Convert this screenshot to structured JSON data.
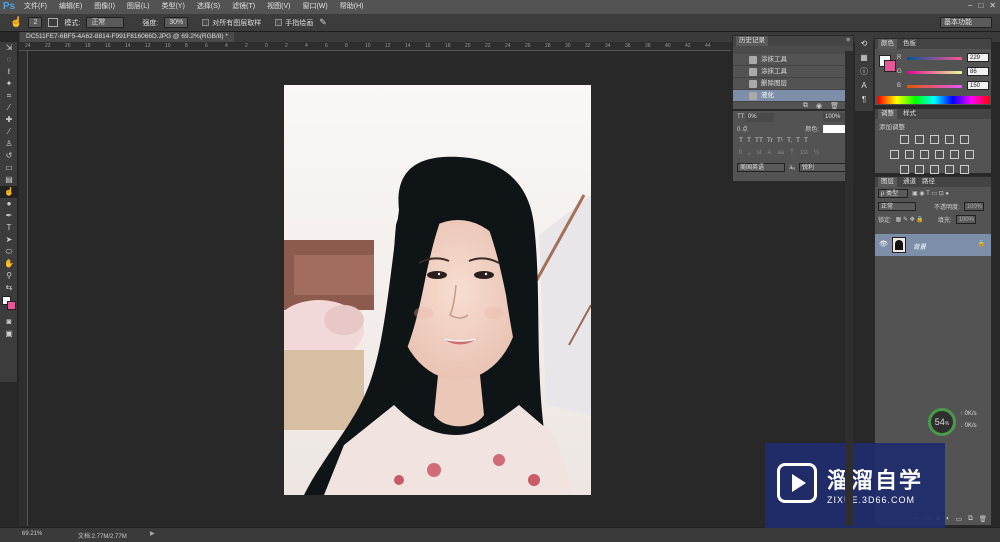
{
  "app": {
    "logo": "Ps"
  },
  "menubar": {
    "items": [
      "文件(F)",
      "编辑(E)",
      "图像(I)",
      "图层(L)",
      "类型(Y)",
      "选择(S)",
      "滤镜(T)",
      "视图(V)",
      "窗口(W)",
      "帮助(H)"
    ],
    "window_controls": [
      "−",
      "□",
      "✕"
    ]
  },
  "options": {
    "brush_size": "2",
    "mode_label": "模式:",
    "mode_value": "正常",
    "strength_label": "强度:",
    "strength_value": "30%",
    "sample_all_label": "对所有图层取样",
    "finger_paint_label": "手指绘画",
    "workspace": "基本功能"
  },
  "document": {
    "tab_title": "DC511FE7-6BF5-4A62-8814-F991F816066D.JPG @ 69.2%(RGB/8) *",
    "ruler_marks": [
      "24",
      "22",
      "20",
      "18",
      "16",
      "14",
      "12",
      "10",
      "8",
      "6",
      "4",
      "2",
      "0",
      "2",
      "4",
      "6",
      "8",
      "10",
      "12",
      "14",
      "16",
      "18",
      "20",
      "22",
      "24",
      "26",
      "28",
      "30",
      "32",
      "34",
      "36",
      "38",
      "40",
      "42",
      "44"
    ]
  },
  "status": {
    "zoom": "69.21%",
    "doc_info": "文档:2.77M/2.77M"
  },
  "history": {
    "title": "历史记录",
    "items": [
      {
        "label": "涂抹工具",
        "selected": false
      },
      {
        "label": "涂抹工具",
        "selected": false
      },
      {
        "label": "删除图层",
        "selected": false
      },
      {
        "label": "液化",
        "selected": true
      }
    ]
  },
  "character": {
    "row1_left": "0%",
    "row1_right": "100%",
    "tracking": "0 点",
    "color_label": "颜色:",
    "style_buttons": [
      "T",
      "T",
      "TT",
      "Tr",
      "T¹",
      "T,",
      "T",
      "T"
    ],
    "ligature_buttons": [
      "fi",
      "ℴ",
      "st",
      "A",
      "aa",
      "T",
      "1st",
      "½"
    ],
    "language": "美国英语",
    "aa_label": "aₐ",
    "antialias": "锐利"
  },
  "color_panel": {
    "tabs": [
      "颜色",
      "色板"
    ],
    "r_label": "R",
    "r_value": "229",
    "g_label": "G",
    "g_value": "86",
    "b_label": "B",
    "b_value": "150",
    "fg_color": "#ffffff",
    "bg_color": "#e55696"
  },
  "adjustments": {
    "tabs": [
      "调整",
      "样式"
    ],
    "add_label": "添加调整"
  },
  "layers": {
    "tabs": [
      "图层",
      "通道",
      "路径"
    ],
    "kind_label": "ρ 类型",
    "blend_mode": "正常",
    "opacity_label": "不透明度:",
    "opacity_value": "100%",
    "lock_label": "锁定:",
    "fill_label": "填充:",
    "fill_value": "100%",
    "layer_name": "背景"
  },
  "speed_widget": {
    "percent": "54",
    "unit": "%",
    "up": "0K/s",
    "down": "0K/s"
  },
  "watermark": {
    "brand": "溜溜自学",
    "url": "ZIXUE.3D66.COM"
  }
}
